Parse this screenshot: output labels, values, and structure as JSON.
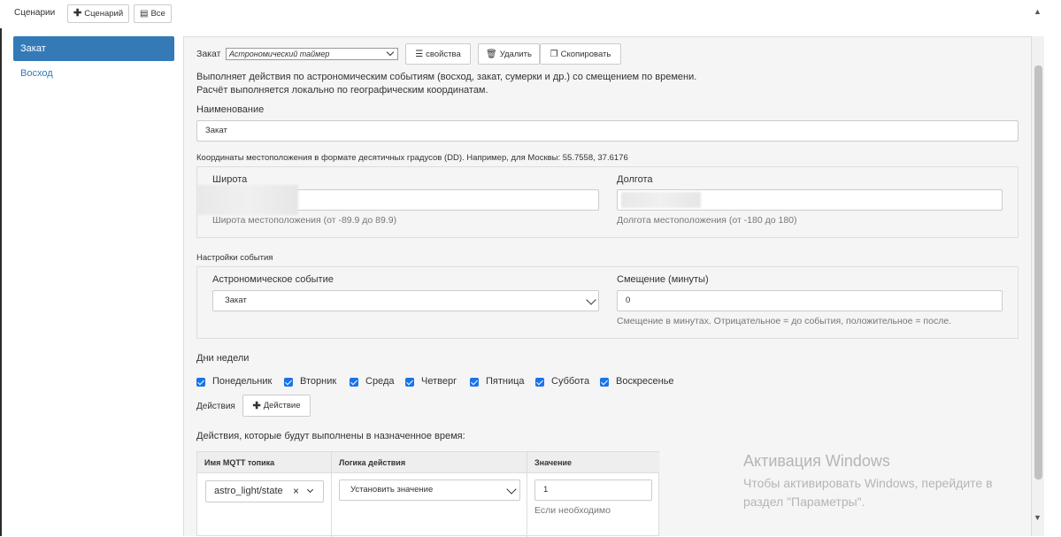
{
  "topbar": {
    "title": "Сценарии",
    "add_scenario": "Сценарий",
    "all": "Все"
  },
  "sidebar": {
    "items": [
      {
        "label": "Закат",
        "active": true
      },
      {
        "label": "Восход",
        "active": false
      }
    ]
  },
  "scenario": {
    "name_prefix": "Закат",
    "type_value": "Астрономический таймер",
    "properties_label": "свойства",
    "delete_label": "Удалить",
    "copy_label": "Скопировать",
    "description_1": "Выполняет действия по астрономическим событиям (восход, закат, сумерки и др.) со смещением по времени.",
    "description_2": "Расчёт выполняется локально по географическим координатам.",
    "name_label": "Наименование",
    "name_value": "Закат"
  },
  "coordinates": {
    "legend": "Координаты местоположения в формате десятичных градусов (DD). Например, для Москвы: 55.7558, 37.6176",
    "lat_label": "Широта",
    "lat_help": "Широта местоположения (от -89.9 до 89.9)",
    "lon_label": "Долгота",
    "lon_help": "Долгота местоположения (от -180 до 180)"
  },
  "event_settings": {
    "legend": "Настройки события",
    "event_label": "Астрономическое событие",
    "event_value": "Закат",
    "offset_label": "Смещение (минуты)",
    "offset_value": "0",
    "offset_help": "Смещение в минутах. Отрицательное = до события, положительное = после."
  },
  "weekdays": {
    "label": "Дни недели",
    "days": [
      {
        "label": "Понедельник",
        "checked": true
      },
      {
        "label": "Вторник",
        "checked": true
      },
      {
        "label": "Среда",
        "checked": true
      },
      {
        "label": "Четверг",
        "checked": true
      },
      {
        "label": "Пятница",
        "checked": true
      },
      {
        "label": "Суббота",
        "checked": true
      },
      {
        "label": "Воскресенье",
        "checked": true
      }
    ]
  },
  "actions": {
    "label": "Действия",
    "add_label": "Действие",
    "description": "Действия, которые будут выполнены в назначенное время:",
    "columns": [
      "Имя MQTT топика",
      "Логика действия",
      "Значение"
    ],
    "rows": [
      {
        "topic": "astro_light/state",
        "logic": "Установить значение",
        "value": "1",
        "value_help": "Если необходимо"
      }
    ]
  },
  "watermark": {
    "title": "Активация Windows",
    "line1": "Чтобы активировать Windows, перейдите в",
    "line2": "раздел \"Параметры\"."
  },
  "colors": {
    "accent": "#337ab7",
    "checkbox": "#1a73e8",
    "panel_bg": "#f5f5f5"
  }
}
